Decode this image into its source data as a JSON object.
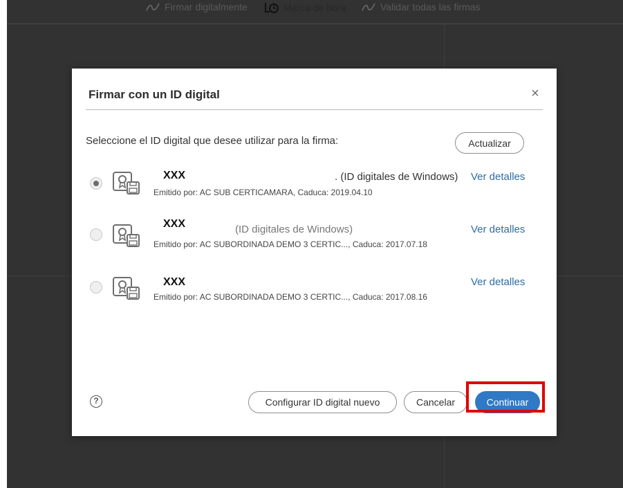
{
  "toolbar": {
    "sign_label": "Firmar digitalmente",
    "timestamp_label": "Marca de hora",
    "validate_label": "Validar todas las firmas"
  },
  "dialog": {
    "title": "Firmar con un ID digital",
    "close_glyph": "×",
    "prompt": "Seleccione el ID digital que desee utilizar para la firma:",
    "refresh_label": "Actualizar",
    "ids": [
      {
        "name": "XXX",
        "store": ". (ID digitales de Windows)",
        "issuer": "Emitido por: AC SUB CERTICAMARA, Caduca: 2019.04.10",
        "details_label": "Ver detalles",
        "selected": true
      },
      {
        "name": "XXX",
        "store": "(ID digitales de Windows)",
        "issuer": "Emitido por: AC SUBORDINADA DEMO 3 CERTIC..., Caduca: 2017.07.18",
        "details_label": "Ver detalles",
        "selected": false
      },
      {
        "name": "XXX",
        "store": "",
        "issuer": "Emitido por: AC SUBORDINADA DEMO 3 CERTIC..., Caduca: 2017.08.16",
        "details_label": "Ver detalles",
        "selected": false
      }
    ],
    "help_glyph": "?",
    "configure_label": "Configurar ID digital nuevo",
    "cancel_label": "Cancelar",
    "continue_label": "Continuar"
  },
  "colors": {
    "background": "#323232",
    "primary_button": "#2f79c6",
    "link": "#2b6ca3",
    "highlight": "#e00000"
  }
}
